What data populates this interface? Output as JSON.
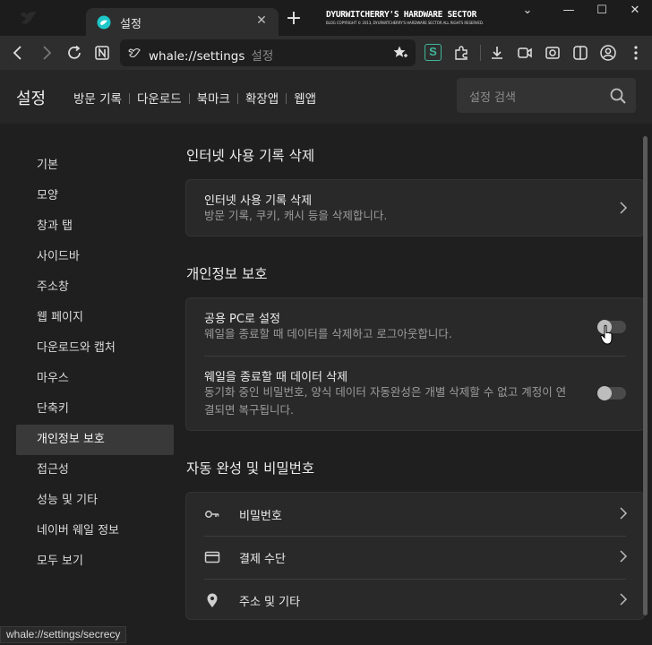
{
  "tabstrip": {
    "tab_title": "설정",
    "new_tab": "+",
    "close": "✕",
    "watermark_title": "DYURWITCHERRY'S HARDWARE SECTOR",
    "watermark_sub": "BLOG COPYRIGHT © 2013, DYURWITCHERRY'S HARDWARE SECTOR ALL RIGHTS RESERVED.",
    "window_buttons": [
      "⌄",
      "—",
      "☐",
      "✕"
    ]
  },
  "toolbar": {
    "url": "whale://settings",
    "url_suffix": "설정",
    "extension_label": "S"
  },
  "header": {
    "title": "설정",
    "links": [
      "방문 기록",
      "다운로드",
      "북마크",
      "확장앱",
      "웹앱"
    ],
    "search_placeholder": "설정 검색"
  },
  "sidebar": {
    "items": [
      "기본",
      "모양",
      "창과 탭",
      "사이드바",
      "주소창",
      "웹 페이지",
      "다운로드와 캡처",
      "마우스",
      "단축키",
      "개인정보 보호",
      "접근성",
      "성능 및 기타",
      "네이버 웨일 정보",
      "모두 보기"
    ],
    "active_index": 9
  },
  "sections": {
    "history": {
      "title": "인터넷 사용 기록 삭제",
      "row_title": "인터넷 사용 기록 삭제",
      "row_desc": "방문 기록, 쿠키, 캐시 등을 삭제합니다."
    },
    "privacy": {
      "title": "개인정보 보호",
      "public_pc_title": "공용 PC로 설정",
      "public_pc_desc": "웨일을 종료할 때 데이터를 삭제하고 로그아웃합니다.",
      "public_pc_enabled": false,
      "clear_on_exit_title": "웨일을 종료할 때 데이터 삭제",
      "clear_on_exit_desc_1": "동기화 중인 비밀번호, 양식 데이터 자동완성은 개별 삭제할 수 없고 계정이 연",
      "clear_on_exit_desc_2": "결되면 복구됩니다.",
      "clear_on_exit_enabled": false
    },
    "autofill": {
      "title": "자동 완성 및 비밀번호",
      "items": [
        {
          "label": "비밀번호",
          "icon": "key-icon"
        },
        {
          "label": "결제 수단",
          "icon": "credit-card-icon"
        },
        {
          "label": "주소 및 기타",
          "icon": "location-pin-icon"
        }
      ]
    }
  },
  "status_bar": {
    "url": "whale://settings/secrecy"
  },
  "colors": {
    "background": "#1f1f1f",
    "card": "#292929",
    "accent_green": "#3fb59a"
  }
}
